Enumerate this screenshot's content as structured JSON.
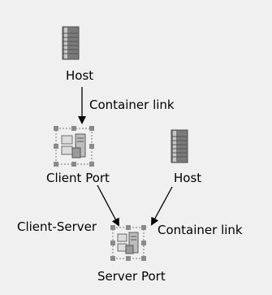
{
  "diagram": {
    "nodes": {
      "host_top": {
        "label": "Host",
        "icon": "server-rack-icon"
      },
      "client_port": {
        "label": "Client Port",
        "icon": "port-node-icon"
      },
      "host_right": {
        "label": "Host",
        "icon": "server-rack-icon"
      },
      "server_port": {
        "label": "Server Port",
        "icon": "port-node-icon"
      }
    },
    "links": {
      "container_link_top": {
        "label": "Container link"
      },
      "client_server": {
        "label": "Client-Server"
      },
      "container_link_right": {
        "label": "Container link"
      }
    }
  },
  "colors": {
    "background": "#f0f0f0",
    "server_dark": "#6b6b6b",
    "server_light": "#c8c8c8",
    "selection_handle": "#8a8a8a",
    "edge": "#000000"
  }
}
